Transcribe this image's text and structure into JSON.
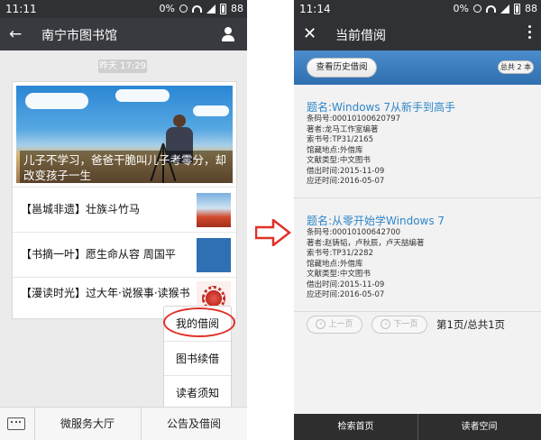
{
  "left": {
    "status": {
      "time": "11:11",
      "battery": "88",
      "signal": "0%"
    },
    "header": {
      "title": "南宁市图书馆"
    },
    "timestamp": "昨天 17:29",
    "hero": {
      "caption": "儿子不学习，爸爸干脆叫儿子考零分，却改变孩子一生"
    },
    "news": [
      {
        "title": "【邕城非遗】壮族斗竹马"
      },
      {
        "title": "【书摘一叶】愿生命从容 周国平"
      },
      {
        "title": "【漫读时光】过大年·说猴事·读猴书"
      }
    ],
    "popup": {
      "items": [
        "我的借阅",
        "图书续借",
        "读者须知"
      ]
    },
    "bottom": {
      "menus": [
        "微服务大厅",
        "公告及借阅"
      ]
    }
  },
  "right": {
    "status": {
      "time": "11:14",
      "battery": "88",
      "signal": "0%"
    },
    "header": {
      "title": "当前借阅"
    },
    "history_button": "查看历史借阅",
    "total": "总共 2 本",
    "books": [
      {
        "title": "题名:Windows 7从新手到高手",
        "lines": [
          "条码号:00010100620797",
          "著者:龙马工作室编著",
          "索书号:TP31/2165",
          "馆藏地点:外借库",
          "文献类型:中文图书",
          "借出时间:2015-11-09",
          "应还时间:2016-05-07"
        ]
      },
      {
        "title": "题名:从零开始学Windows 7",
        "lines": [
          "条码号:00010100642700",
          "著者:赵铸韬，卢秋辰，卢天喆编著",
          "索书号:TP31/2282",
          "馆藏地点:外借库",
          "文献类型:中文图书",
          "借出时间:2015-11-09",
          "应还时间:2016-05-07"
        ]
      }
    ],
    "pager": {
      "prev": "上一页",
      "next": "下一页",
      "info": "第1页/总共1页"
    },
    "tabs": [
      "检索首页",
      "读者空间"
    ]
  },
  "colors": {
    "accent_red": "#e03127",
    "link_blue": "#2f86c8",
    "band_blue": "#3a7cbd",
    "wechat_dark": "#393a3f"
  }
}
